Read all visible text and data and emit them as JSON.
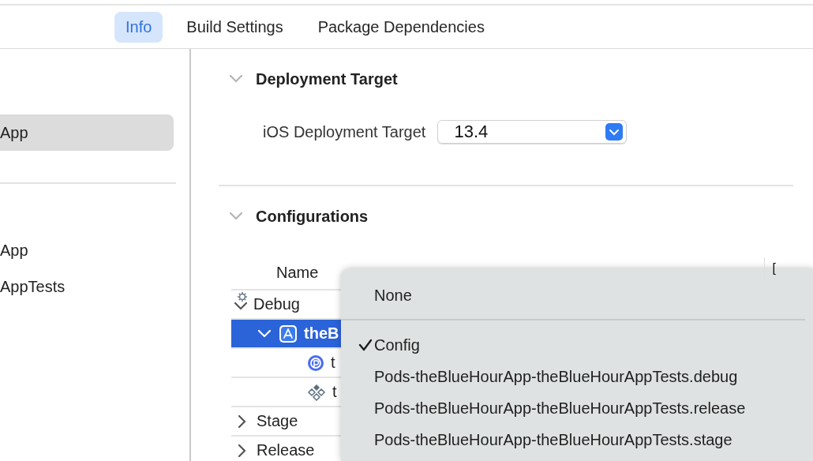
{
  "tabs": [
    {
      "label": "Info",
      "selected": true
    },
    {
      "label": "Build Settings",
      "selected": false
    },
    {
      "label": "Package Dependencies",
      "selected": false
    }
  ],
  "sidebar": {
    "project_items": [
      {
        "label": "App",
        "selected": true
      }
    ],
    "target_items": [
      {
        "label": "App",
        "selected": false
      },
      {
        "label": "AppTests",
        "selected": false
      }
    ]
  },
  "deployment_target": {
    "title": "Deployment Target",
    "expanded": true,
    "label": "iOS Deployment Target",
    "value": "13.4"
  },
  "configurations": {
    "title": "Configurations",
    "expanded": true,
    "columns": [
      "Name",
      "["
    ],
    "rows": [
      {
        "label": "Debug",
        "kind": "gear",
        "expanded": true,
        "selected": false,
        "children": [
          {
            "label": "theB",
            "kind": "app",
            "expanded": true,
            "selected": true,
            "children": [
              {
                "label": "t",
                "kind": "pod",
                "selected": false
              },
              {
                "label": "t",
                "kind": "diamonds",
                "selected": false
              }
            ]
          }
        ]
      },
      {
        "label": "Stage",
        "expanded": false,
        "selected": false
      },
      {
        "label": "Release",
        "expanded": false,
        "selected": false
      }
    ]
  },
  "menu": {
    "items": [
      {
        "kind": "item",
        "label": "None",
        "checked": false
      },
      {
        "kind": "separator"
      },
      {
        "kind": "item",
        "label": "Config",
        "checked": true
      },
      {
        "kind": "item",
        "label": "Pods-theBlueHourApp-theBlueHourAppTests.debug",
        "checked": false
      },
      {
        "kind": "item",
        "label": "Pods-theBlueHourApp-theBlueHourAppTests.release",
        "checked": false
      },
      {
        "kind": "item",
        "label": "Pods-theBlueHourApp-theBlueHourAppTests.stage",
        "checked": false
      }
    ]
  }
}
